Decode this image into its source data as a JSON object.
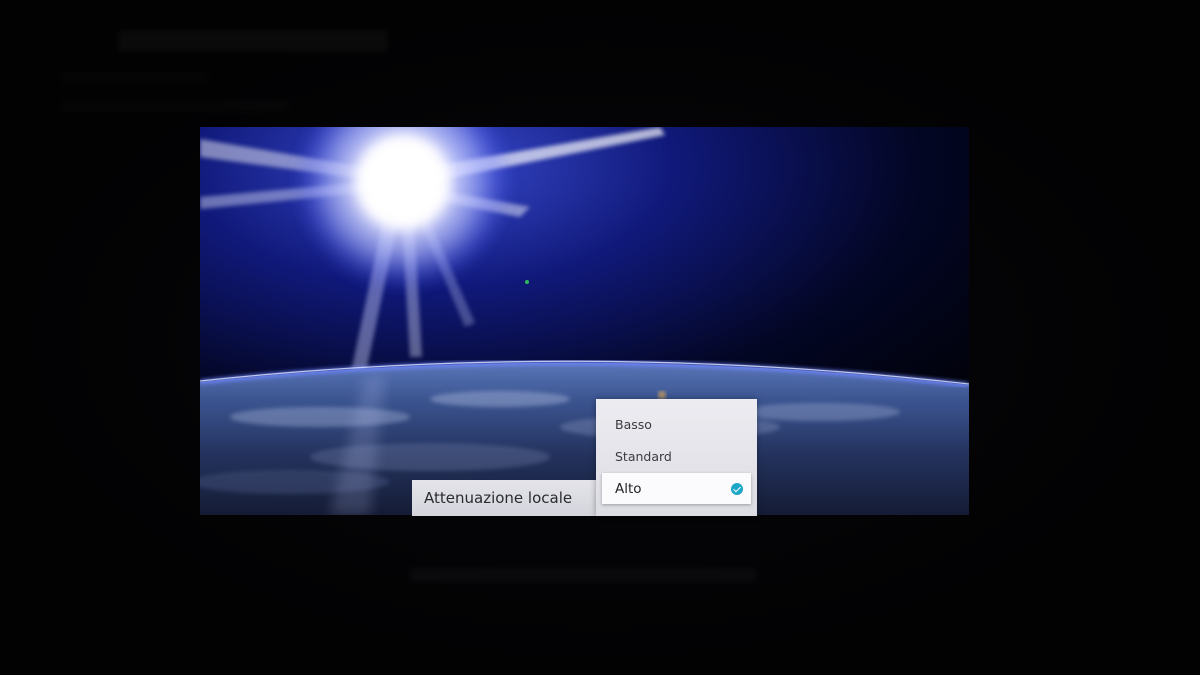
{
  "picture_setting": {
    "label": "Attenuazione locale"
  },
  "dropdown": {
    "options": [
      {
        "label": "Basso",
        "selected": false
      },
      {
        "label": "Standard",
        "selected": false
      },
      {
        "label": "Alto",
        "selected": true
      }
    ]
  },
  "colors": {
    "accent_check": "#1ca6c8",
    "panel_background": "#e4e4ea"
  },
  "icons": {
    "selected_indicator": "check-circle-icon"
  }
}
